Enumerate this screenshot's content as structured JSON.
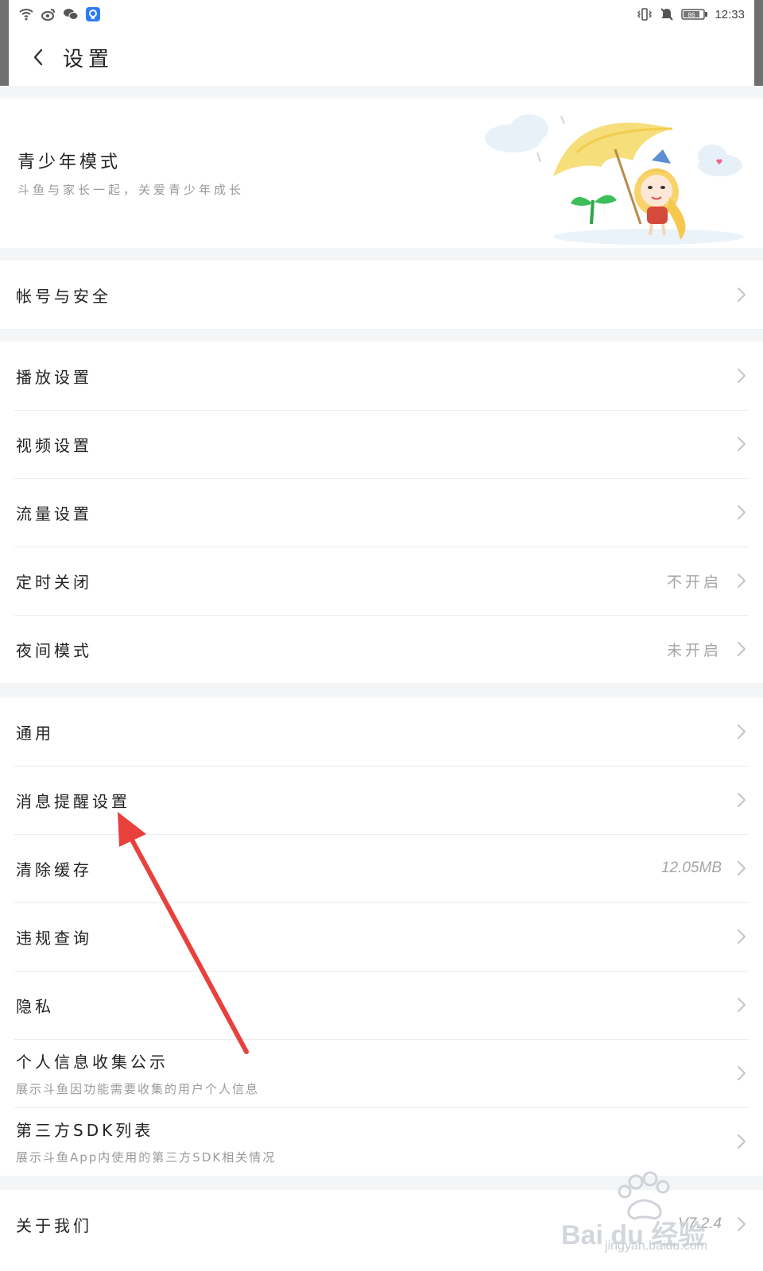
{
  "status_bar": {
    "time": "12:33",
    "battery": "86",
    "left_icons": [
      "wifi-icon",
      "weibo-icon",
      "wechat-icon",
      "app-badge-icon"
    ],
    "right_icons": [
      "vibrate-icon",
      "mute-icon",
      "battery-icon"
    ]
  },
  "header": {
    "title": "设置"
  },
  "banner": {
    "title": "青少年模式",
    "subtitle": "斗鱼与家长一起，关爱青少年成长"
  },
  "groups": [
    {
      "items": [
        {
          "label": "帐号与安全"
        }
      ]
    },
    {
      "items": [
        {
          "label": "播放设置"
        },
        {
          "label": "视频设置"
        },
        {
          "label": "流量设置"
        },
        {
          "label": "定时关闭",
          "value": "不开启"
        },
        {
          "label": "夜间模式",
          "value": "未开启"
        }
      ]
    },
    {
      "items": [
        {
          "label": "通用"
        },
        {
          "label": "消息提醒设置"
        },
        {
          "label": "清除缓存",
          "value": "12.05MB"
        },
        {
          "label": "违规查询"
        },
        {
          "label": "隐私"
        },
        {
          "label": "个人信息收集公示",
          "subtitle": "展示斗鱼因功能需要收集的用户个人信息"
        },
        {
          "label": "第三方SDK列表",
          "subtitle": "展示斗鱼App内使用的第三方SDK相关情况"
        }
      ]
    },
    {
      "items": [
        {
          "label": "关于我们",
          "value": "V7.2.4"
        }
      ]
    }
  ],
  "watermark": {
    "brand": "Bai du 经验",
    "url": "jingyan.baidu.com"
  },
  "colors": {
    "annotation_arrow": "#e8413c",
    "chevron": "#c4c4c4",
    "separator": "#f4f5f7"
  }
}
